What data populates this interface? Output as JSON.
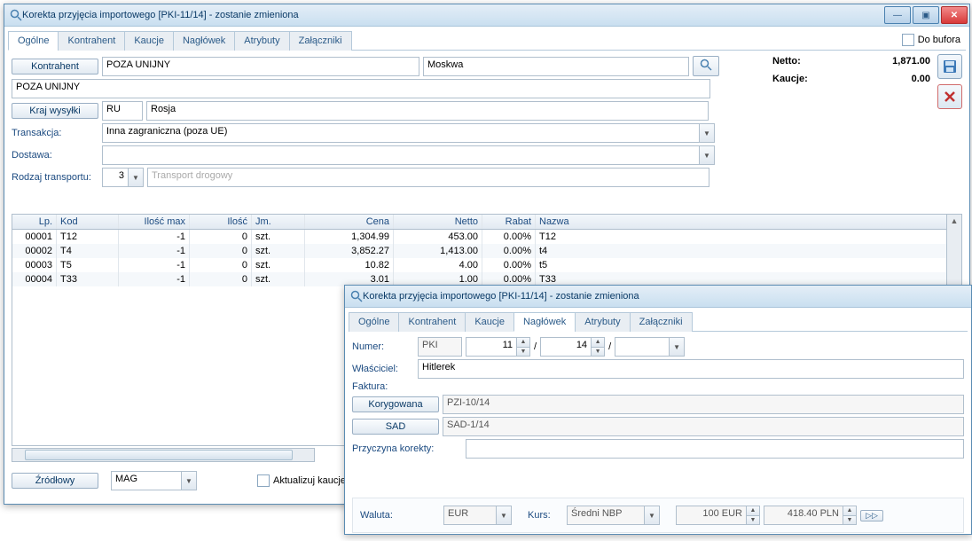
{
  "win1": {
    "title": "Korekta przyjęcia importowego [PKI-11/14]  - zostanie zmieniona",
    "tabs": [
      "Ogólne",
      "Kontrahent",
      "Kaucje",
      "Nagłówek",
      "Atrybuty",
      "Załączniki"
    ],
    "buffer_label": "Do bufora",
    "kontrahent_btn": "Kontrahent",
    "kontrahent_name": "POZA UNIJNY",
    "kontrahent_city": "Moskwa",
    "kontrahent_name2": "POZA UNIJNY",
    "kraj_btn": "Kraj wysyłki",
    "kraj_code": "RU",
    "kraj_name": "Rosja",
    "trans_label": "Transakcja:",
    "trans_val": "Inna zagraniczna (poza UE)",
    "dostawa_label": "Dostawa:",
    "dostawa_val": "",
    "rodzaj_label": "Rodzaj transportu:",
    "rodzaj_num": "3",
    "rodzaj_desc": "Transport drogowy",
    "netto_label": "Netto:",
    "netto_val": "1,871.00",
    "kaucje_label": "Kaucje:",
    "kaucje_val": "0.00",
    "grid_head": {
      "lp": "Lp.",
      "kod": "Kod",
      "imax": "Ilość max",
      "ilosc": "Ilość",
      "jm": "Jm.",
      "cena": "Cena",
      "netto": "Netto",
      "rabat": "Rabat",
      "nazwa": "Nazwa"
    },
    "rows": [
      {
        "lp": "00001",
        "kod": "T12",
        "imax": "-1",
        "ilosc": "0",
        "jm": "szt.",
        "cena": "1,304.99",
        "netto": "453.00",
        "rabat": "0.00%",
        "nazwa": "T12"
      },
      {
        "lp": "00002",
        "kod": "T4",
        "imax": "-1",
        "ilosc": "0",
        "jm": "szt.",
        "cena": "3,852.27",
        "netto": "1,413.00",
        "rabat": "0.00%",
        "nazwa": "t4"
      },
      {
        "lp": "00003",
        "kod": "T5",
        "imax": "-1",
        "ilosc": "0",
        "jm": "szt.",
        "cena": "10.82",
        "netto": "4.00",
        "rabat": "0.00%",
        "nazwa": "t5"
      },
      {
        "lp": "00004",
        "kod": "T33",
        "imax": "-1",
        "ilosc": "0",
        "jm": "szt.",
        "cena": "3.01",
        "netto": "1.00",
        "rabat": "0.00%",
        "nazwa": "T33"
      }
    ],
    "zrodlowy_btn": "Źródłowy",
    "mag_val": "MAG",
    "akt_kaucje": "Aktualizuj kaucje"
  },
  "win2": {
    "title": "Korekta przyjęcia importowego [PKI-11/14]  - zostanie zmieniona",
    "tabs": [
      "Ogólne",
      "Kontrahent",
      "Kaucje",
      "Nagłówek",
      "Atrybuty",
      "Załączniki"
    ],
    "numer_label": "Numer:",
    "numer_series": "PKI",
    "numer_no1": "11",
    "numer_no2": "14",
    "wlasciciel_label": "Właściciel:",
    "wlasciciel_val": "Hitlerek",
    "faktura_label": "Faktura:",
    "korygowana_btn": "Korygowana",
    "korygowana_val": "PZI-10/14",
    "sad_btn": "SAD",
    "sad_val": "SAD-1/14",
    "przyczyna_label": "Przyczyna korekty:",
    "przyczyna_val": "",
    "waluta_label": "Waluta:",
    "waluta_val": "EUR",
    "kurs_label": "Kurs:",
    "kurs_val": "Średni NBP",
    "rate_a": "100 EUR",
    "rate_b": "418.40 PLN"
  }
}
